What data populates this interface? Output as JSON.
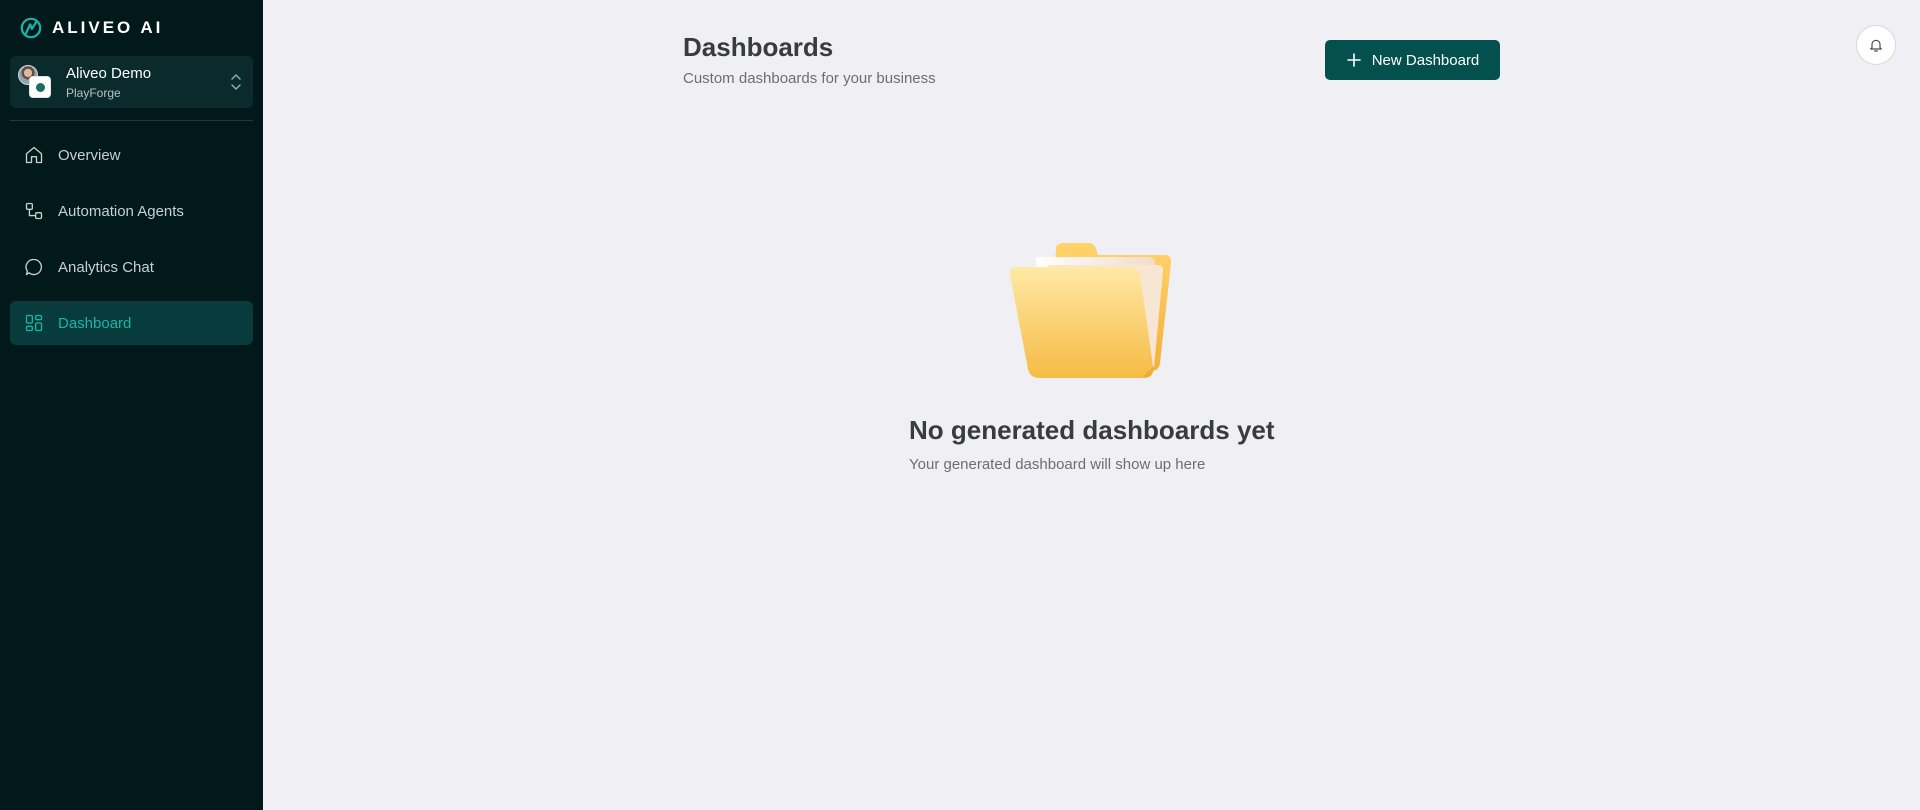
{
  "brand": {
    "name": "ALIVEO AI",
    "accent": "#19b5a7"
  },
  "workspace": {
    "name": "Aliveo Demo",
    "org": "PlayForge"
  },
  "nav": {
    "items": [
      {
        "label": "Overview",
        "icon": "home-icon",
        "active": false
      },
      {
        "label": "Automation Agents",
        "icon": "workflow-icon",
        "active": false
      },
      {
        "label": "Analytics Chat",
        "icon": "chat-bubble-icon",
        "active": false
      },
      {
        "label": "Dashboard",
        "icon": "layout-grid-icon",
        "active": true
      }
    ]
  },
  "header": {
    "title": "Dashboards",
    "subtitle": "Custom dashboards for your business",
    "new_button_label": "New Dashboard",
    "notification_icon": "bell-icon"
  },
  "empty_state": {
    "icon": "folder-icon",
    "title": "No generated dashboards yet",
    "subtitle": "Your generated dashboard will show up here"
  },
  "colors": {
    "sidebar_bg": "#02191b",
    "primary_button": "#03504f",
    "page_bg": "#f0f0f4"
  }
}
